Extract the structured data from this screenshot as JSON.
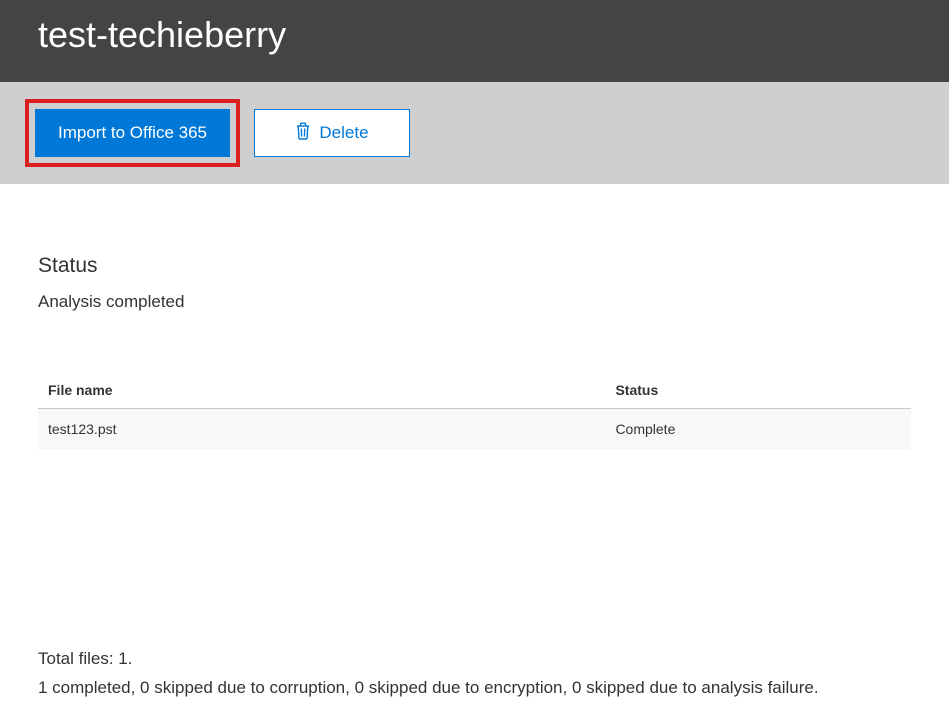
{
  "header": {
    "title": "test-techieberry"
  },
  "actions": {
    "import_label": "Import to Office 365",
    "delete_label": "Delete"
  },
  "status": {
    "heading": "Status",
    "message": "Analysis completed"
  },
  "table": {
    "columns": {
      "filename": "File name",
      "status": "Status"
    },
    "rows": [
      {
        "filename": "test123.pst",
        "status": "Complete"
      }
    ]
  },
  "summary": {
    "total_files_label": "Total files: 1.",
    "detail_line": "1 completed, 0 skipped due to corruption, 0 skipped due to encryption, 0 skipped due to analysis failure."
  },
  "colors": {
    "primary": "#0078d7",
    "highlight": "#d9201f",
    "header_bg": "#444444",
    "action_bg": "#cfcfcf"
  }
}
